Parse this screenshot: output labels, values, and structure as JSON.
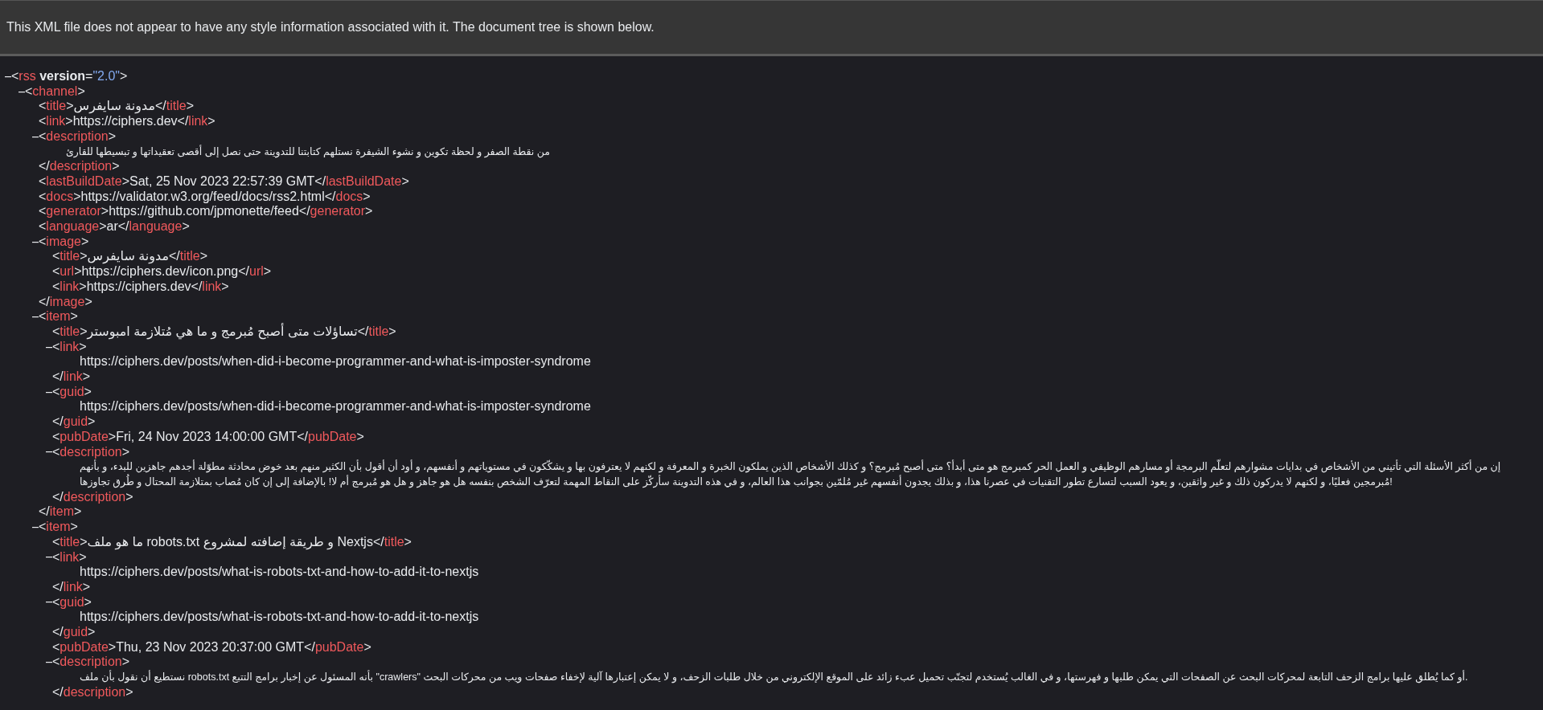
{
  "notice": "This XML file does not appear to have any style information associated with it. The document tree is shown below.",
  "tree": {
    "kind": "collapsible",
    "expanded": true,
    "open": "<rss version=\"2.0\">",
    "children": [
      {
        "kind": "collapsible",
        "expanded": true,
        "open": "<channel>",
        "children": [
          {
            "kind": "inline",
            "open": "<title>",
            "text": "مدونة سايفرس",
            "close": "</title>"
          },
          {
            "kind": "inline",
            "open": "<link>",
            "text": "https://ciphers.dev",
            "close": "</link>"
          },
          {
            "kind": "collapsible",
            "expanded": true,
            "open": "<description>",
            "close": "</description>",
            "children": [
              {
                "kind": "paragraph",
                "text": "من نقطة الصفر و لحظة تكوين و نشوء الشيفرة نستلهم كتابتنا للتدوينة حتى نصل إلى أقصى تعقيداتها و تبسيطها للقارئ"
              }
            ]
          },
          {
            "kind": "inline",
            "open": "<lastBuildDate>",
            "text": "Sat, 25 Nov 2023 22:57:39 GMT",
            "close": "</lastBuildDate>"
          },
          {
            "kind": "inline",
            "open": "<docs>",
            "text": "https://validator.w3.org/feed/docs/rss2.html",
            "close": "</docs>"
          },
          {
            "kind": "inline",
            "open": "<generator>",
            "text": "https://github.com/jpmonette/feed",
            "close": "</generator>"
          },
          {
            "kind": "inline",
            "open": "<language>",
            "text": "ar",
            "close": "</language>"
          },
          {
            "kind": "collapsible",
            "expanded": true,
            "open": "<image>",
            "close": "</image>",
            "children": [
              {
                "kind": "inline",
                "open": "<title>",
                "text": "مدونة سايفرس",
                "close": "</title>"
              },
              {
                "kind": "inline",
                "open": "<url>",
                "text": "https://ciphers.dev/icon.png",
                "close": "</url>"
              },
              {
                "kind": "inline",
                "open": "<link>",
                "text": "https://ciphers.dev",
                "close": "</link>"
              }
            ]
          },
          {
            "kind": "collapsible",
            "expanded": true,
            "open": "<item>",
            "close": "</item>",
            "children": [
              {
                "kind": "inline",
                "open": "<title>",
                "text": "تساؤلات متى أصبح مُبرمج و ما هي مُتلازمة امبوستر",
                "close": "</title>"
              },
              {
                "kind": "collapsible",
                "expanded": true,
                "open": "<link>",
                "close": "</link>",
                "children": [
                  {
                    "kind": "text",
                    "text": "https://ciphers.dev/posts/when-did-i-become-programmer-and-what-is-imposter-syndrome"
                  }
                ]
              },
              {
                "kind": "collapsible",
                "expanded": true,
                "open": "<guid>",
                "close": "</guid>",
                "children": [
                  {
                    "kind": "text",
                    "text": "https://ciphers.dev/posts/when-did-i-become-programmer-and-what-is-imposter-syndrome"
                  }
                ]
              },
              {
                "kind": "inline",
                "open": "<pubDate>",
                "text": "Fri, 24 Nov 2023 14:00:00 GMT",
                "close": "</pubDate>"
              },
              {
                "kind": "collapsible",
                "expanded": true,
                "open": "<description>",
                "close": "</description>",
                "children": [
                  {
                    "kind": "paragraph",
                    "text": "إن من أكثر الأسئلة التي تأتيني من الأشخاص في بدايات مشوارهم لتعلّم البرمجة أو مسارهم الوظيفي و العمل الحر كمبرمج هو متى أبدأ؟ متى أصبح مُبرمج؟ و كذلك الأشخاص الذين يملكون الخبرة و المعرفة و لكنهم لا يعترفون بها و يشكّكون في مستوياتهم و أنفسهم، و أود أن أقول بأن الكثير منهم بعد خوض محادثة مطوّلة أجدهم جاهزين للبدء، و بأنهم مُبرمجين فعليًا، و لكنهم لا يدركون ذلك و غير واثقين، و يعود السبب لتسارع تطور التقنيات في عصرنا هذا، و بذلك يجدون أنفسهم غير مُلمّين بجوانب هذا العالم، و في هذه التدوينة سأركّز على النقاط المهمة لتعرّف الشخص بنفسه هل هو جاهز و هل هو مُبرمج أم لا! بالإضافة إلى إن كان مُصاب بمتلازمة المحتال و طُرق تجاوزها!"
                  }
                ]
              }
            ]
          },
          {
            "kind": "collapsible",
            "expanded": true,
            "open": "<item>",
            "children": [
              {
                "kind": "inline",
                "open": "<title>",
                "text": "ما هو ملف robots.txt و طريقة إضافته لمشروع Nextjs",
                "close": "</title>"
              },
              {
                "kind": "collapsible",
                "expanded": true,
                "open": "<link>",
                "close": "</link>",
                "children": [
                  {
                    "kind": "text",
                    "text": "https://ciphers.dev/posts/what-is-robots-txt-and-how-to-add-it-to-nextjs"
                  }
                ]
              },
              {
                "kind": "collapsible",
                "expanded": true,
                "open": "<guid>",
                "close": "</guid>",
                "children": [
                  {
                    "kind": "text",
                    "text": "https://ciphers.dev/posts/what-is-robots-txt-and-how-to-add-it-to-nextjs"
                  }
                ]
              },
              {
                "kind": "inline",
                "open": "<pubDate>",
                "text": "Thu, 23 Nov 2023 20:37:00 GMT",
                "close": "</pubDate>"
              },
              {
                "kind": "collapsible",
                "expanded": true,
                "open": "<description>",
                "close": "</description>",
                "children": [
                  {
                    "kind": "paragraph",
                    "text": "نستطيع أن نقول بأن ملف robots.txt بأنه المسئول عن إخبار برامج التتبع \"crawlers\" أو كما يُطلق عليها برامج الزحف التابعة لمحركات البحث عن الصفحات التي يمكن طلبها و فهرستها، و في الغالب يُستخدم لتجنّب تحميل عبء زائد على الموقع الإلكتروني من خلال طلبات الزحف، و لا يمكن إعتبارها آلية لإخفاء صفحات ويب من محركات البحث."
                  }
                ]
              }
            ]
          }
        ]
      }
    ]
  }
}
